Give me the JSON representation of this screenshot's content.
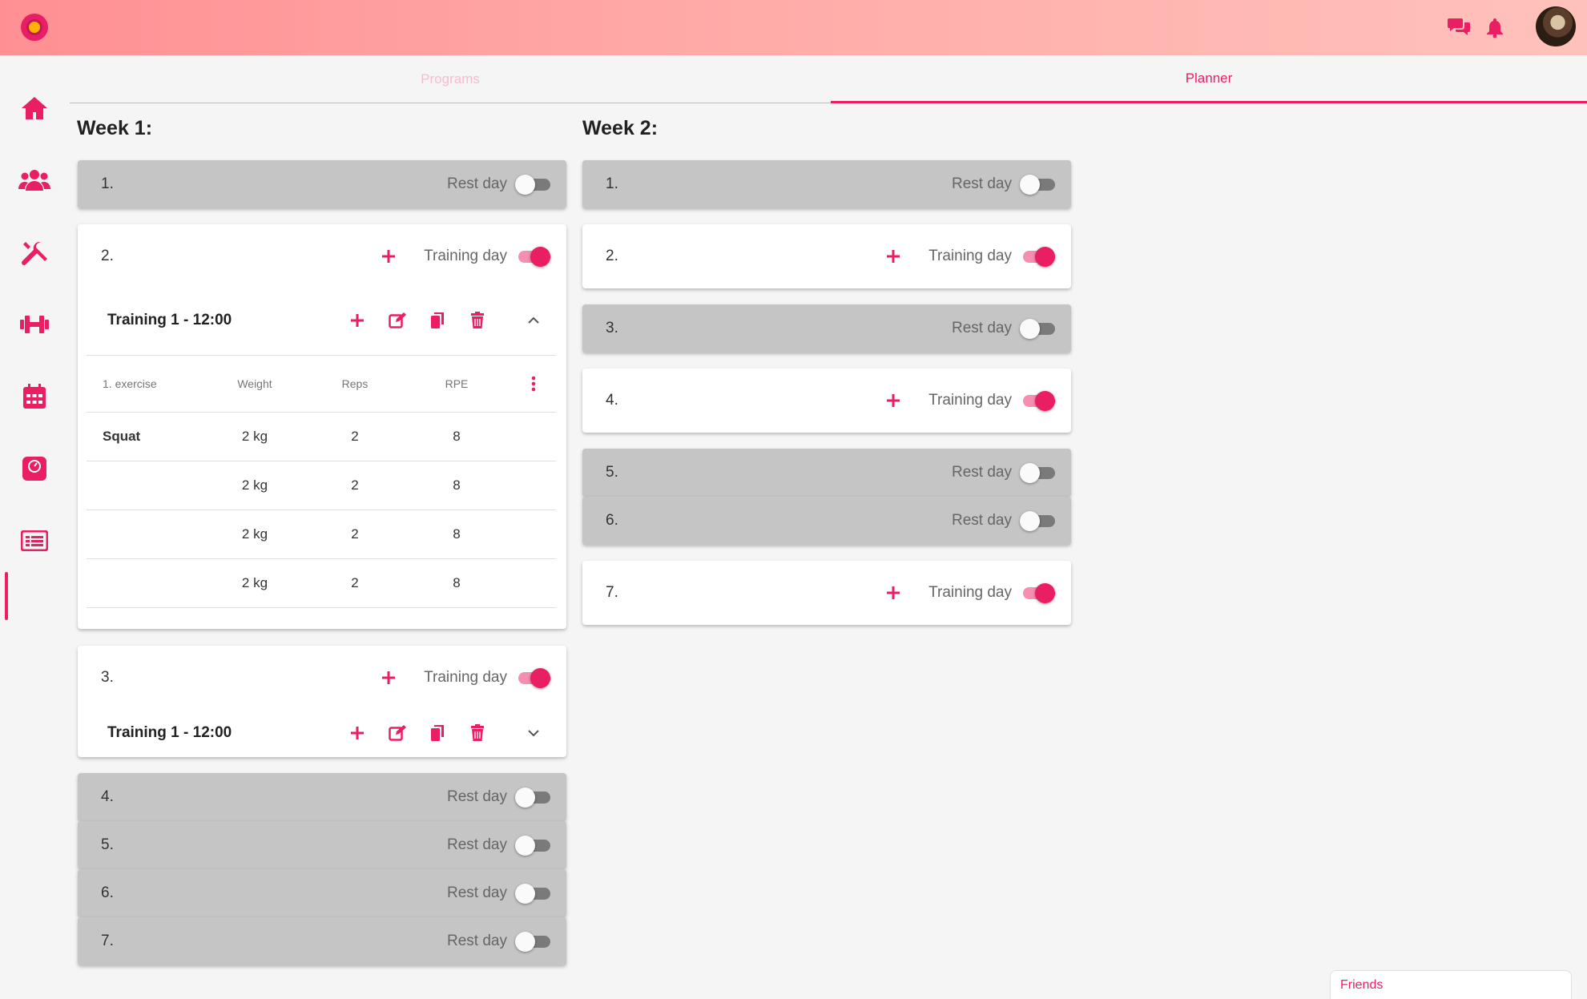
{
  "colors": {
    "accent": "#e91e63",
    "rest_card": "#c5c5c5",
    "training_card": "#ffffff"
  },
  "topbar": {
    "logo_icon": "lion-logo-icon",
    "chat_icon": "chat-icon",
    "bell_icon": "bell-icon",
    "avatar": "user-avatar"
  },
  "sidebar": {
    "items": [
      "home-icon",
      "users-icon",
      "tools-icon",
      "dumbbell-icon",
      "calendar-icon",
      "scale-icon",
      "planner-list-icon"
    ],
    "active": "planner-list-icon"
  },
  "tabs": {
    "programs": "Programs",
    "planner": "Planner",
    "active": "Planner"
  },
  "week1": {
    "title": "Week 1:",
    "days": [
      {
        "num": "1.",
        "label": "Rest day",
        "on": false
      },
      {
        "num": "2.",
        "label": "Training day",
        "on": true,
        "training": {
          "title": "Training 1 - 12:00",
          "expanded": true,
          "headers": [
            "1. exercise",
            "Weight",
            "Reps",
            "RPE"
          ],
          "rows": [
            {
              "exercise": "Squat",
              "weight": "2 kg",
              "reps": "2",
              "rpe": "8"
            },
            {
              "exercise": "",
              "weight": "2 kg",
              "reps": "2",
              "rpe": "8"
            },
            {
              "exercise": "",
              "weight": "2 kg",
              "reps": "2",
              "rpe": "8"
            },
            {
              "exercise": "",
              "weight": "2 kg",
              "reps": "2",
              "rpe": "8"
            }
          ]
        }
      },
      {
        "num": "3.",
        "label": "Training day",
        "on": true,
        "training": {
          "title": "Training 1 - 12:00",
          "expanded": false
        }
      },
      {
        "num": "4.",
        "label": "Rest day",
        "on": false
      },
      {
        "num": "5.",
        "label": "Rest day",
        "on": false
      },
      {
        "num": "6.",
        "label": "Rest day",
        "on": false
      },
      {
        "num": "7.",
        "label": "Rest day",
        "on": false
      }
    ]
  },
  "week2": {
    "title": "Week 2:",
    "days": [
      {
        "num": "1.",
        "label": "Rest day",
        "on": false
      },
      {
        "num": "2.",
        "label": "Training day",
        "on": true
      },
      {
        "num": "3.",
        "label": "Rest day",
        "on": false
      },
      {
        "num": "4.",
        "label": "Training day",
        "on": true
      },
      {
        "num": "5.",
        "label": "Rest day",
        "on": false
      },
      {
        "num": "6.",
        "label": "Rest day",
        "on": false
      },
      {
        "num": "7.",
        "label": "Training day",
        "on": true
      }
    ]
  },
  "friends": {
    "label": "Friends"
  }
}
